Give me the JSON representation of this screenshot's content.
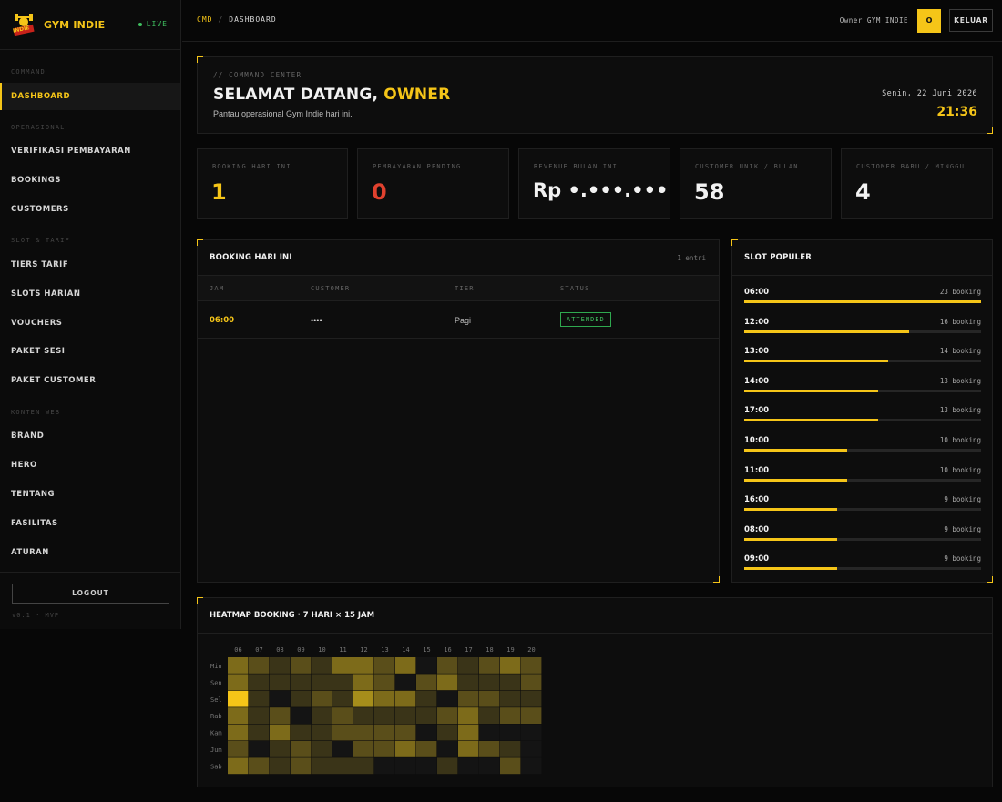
{
  "app": {
    "name": "GYM INDIE",
    "logo_text": "INDIE",
    "live": "LIVE",
    "version": "v0.1 · MVP",
    "logout": "LOGOUT"
  },
  "sidebar": {
    "sections": [
      {
        "label": "COMMAND"
      },
      {
        "label": "OPERASIONAL"
      },
      {
        "label": "SLOT & TARIF"
      },
      {
        "label": "KONTEN WEB"
      }
    ],
    "items": [
      {
        "label": "DASHBOARD",
        "active": true
      },
      {
        "label": "VERIFIKASI PEMBAYARAN"
      },
      {
        "label": "BOOKINGS"
      },
      {
        "label": "CUSTOMERS"
      },
      {
        "label": "TIERS TARIF"
      },
      {
        "label": "SLOTS HARIAN"
      },
      {
        "label": "VOUCHERS"
      },
      {
        "label": "PAKET SESI"
      },
      {
        "label": "PAKET CUSTOMER"
      },
      {
        "label": "BRAND"
      },
      {
        "label": "HERO"
      },
      {
        "label": "TENTANG"
      },
      {
        "label": "FASILITAS"
      },
      {
        "label": "ATURAN"
      }
    ]
  },
  "topbar": {
    "crumb_root": "CMD",
    "crumb_sep": "/",
    "crumb_page": "DASHBOARD",
    "user": "Owner GYM INDIE",
    "avatar": "O",
    "keluar": "KELUAR"
  },
  "welcome": {
    "eyebrow": "// COMMAND CENTER",
    "title": "SELAMAT DATANG, ",
    "title_highlight": "OWNER",
    "subtitle": "Pantau operasional Gym Indie hari ini.",
    "date": "Senin, 22 Juni 2026",
    "time": "21:36"
  },
  "stats": [
    {
      "label": "BOOKING HARI INI",
      "value": "1",
      "color": "#f5c518"
    },
    {
      "label": "PEMBAYARAN PENDING",
      "value": "0",
      "color": "#e0412e"
    },
    {
      "label": "REVENUE BULAN INI",
      "value": "Rp •.•••.•••",
      "color": "#f2f2f2"
    },
    {
      "label": "CUSTOMER UNIK / BULAN",
      "value": "58",
      "color": "#f2f2f2"
    },
    {
      "label": "CUSTOMER BARU / MINGGU",
      "value": "4",
      "color": "#f2f2f2"
    }
  ],
  "booking": {
    "title": "BOOKING HARI INI",
    "count": "1 entri",
    "columns": [
      "JAM",
      "CUSTOMER",
      "TIER",
      "STATUS"
    ],
    "rows": [
      {
        "jam": "06:00",
        "customer": "••••",
        "tier": "Pagi",
        "status": "ATTENDED"
      }
    ]
  },
  "slots": {
    "title": "SLOT POPULER",
    "max": 23,
    "items": [
      {
        "time": "06:00",
        "count": 23,
        "label": "23 booking"
      },
      {
        "time": "12:00",
        "count": 16,
        "label": "16 booking"
      },
      {
        "time": "13:00",
        "count": 14,
        "label": "14 booking"
      },
      {
        "time": "14:00",
        "count": 13,
        "label": "13 booking"
      },
      {
        "time": "17:00",
        "count": 13,
        "label": "13 booking"
      },
      {
        "time": "10:00",
        "count": 10,
        "label": "10 booking"
      },
      {
        "time": "11:00",
        "count": 10,
        "label": "10 booking"
      },
      {
        "time": "16:00",
        "count": 9,
        "label": "9 booking"
      },
      {
        "time": "08:00",
        "count": 9,
        "label": "9 booking"
      },
      {
        "time": "09:00",
        "count": 9,
        "label": "9 booking"
      }
    ]
  },
  "heatmap": {
    "title": "HEATMAP BOOKING · 7 HARI × 15 JAM",
    "hours": [
      "06",
      "07",
      "08",
      "09",
      "10",
      "11",
      "12",
      "13",
      "14",
      "15",
      "16",
      "17",
      "18",
      "19",
      "20"
    ],
    "days": [
      "Min",
      "Sen",
      "Sel",
      "Rab",
      "Kam",
      "Jum",
      "Sab"
    ],
    "values": [
      [
        3,
        2,
        1,
        2,
        1,
        3,
        3,
        2,
        3,
        0,
        2,
        1,
        2,
        3,
        2
      ],
      [
        3,
        1,
        1,
        1,
        1,
        1,
        3,
        2,
        0,
        2,
        3,
        1,
        1,
        1,
        2
      ],
      [
        5,
        1,
        0,
        1,
        2,
        1,
        4,
        3,
        3,
        1,
        0,
        2,
        2,
        1,
        1
      ],
      [
        3,
        1,
        2,
        0,
        1,
        2,
        1,
        1,
        1,
        1,
        2,
        3,
        1,
        2,
        2
      ],
      [
        3,
        1,
        3,
        1,
        1,
        2,
        2,
        2,
        2,
        0,
        1,
        3,
        0,
        0,
        0
      ],
      [
        2,
        0,
        1,
        2,
        1,
        0,
        2,
        2,
        3,
        2,
        0,
        3,
        2,
        1,
        0
      ],
      [
        3,
        2,
        1,
        2,
        1,
        1,
        1,
        0,
        0,
        0,
        1,
        0,
        0,
        2,
        0
      ]
    ]
  },
  "colors": {
    "accent": "#f5c518",
    "danger": "#e0412e",
    "success": "#3fbf5f",
    "bg": "#070707",
    "panel": "#0d0d0d"
  }
}
